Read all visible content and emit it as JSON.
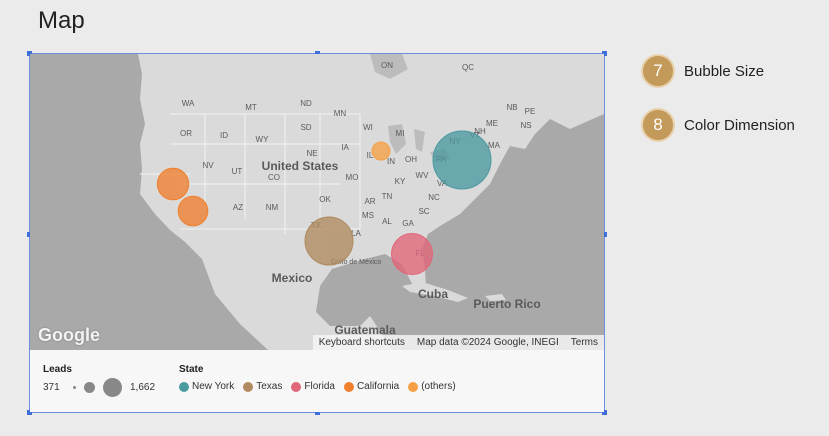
{
  "page": {
    "title": "Map"
  },
  "map": {
    "labels": {
      "countries": [
        "United States",
        "Mexico",
        "Cuba",
        "Puerto Rico",
        "Guatemala"
      ],
      "states": [
        "WA",
        "MT",
        "ND",
        "MN",
        "OR",
        "ID",
        "WY",
        "SD",
        "WI",
        "MI",
        "NV",
        "NE",
        "IA",
        "IL",
        "IN",
        "OH",
        "PA",
        "NY",
        "UT",
        "CO",
        "MO",
        "KY",
        "WV",
        "VA",
        "AZ",
        "NM",
        "OK",
        "AR",
        "TN",
        "NC",
        "MS",
        "AL",
        "GA",
        "SC",
        "TX",
        "LA",
        "FL",
        "ME",
        "VT",
        "NH",
        "MA",
        "NB",
        "PE",
        "NS",
        "ON",
        "QC",
        "Golfo de México"
      ]
    },
    "logo": "Google",
    "attribution": {
      "shortcuts": "Keyboard shortcuts",
      "data": "Map data ©2024 Google, INEGI",
      "terms": "Terms"
    },
    "bubbles": [
      {
        "state": "New York",
        "leads": 1662,
        "color": "#4c9aa0"
      },
      {
        "state": "Texas",
        "leads": 1250,
        "color": "#b08a5e"
      },
      {
        "state": "Florida",
        "leads": 1000,
        "color": "#e2667a"
      },
      {
        "state": "California",
        "leads": 700,
        "color": "#f07f2e"
      },
      {
        "state": "California",
        "leads": 650,
        "color": "#f07f2e"
      },
      {
        "state": "Illinois",
        "leads": 371,
        "color": "#f5a045"
      }
    ]
  },
  "legend": {
    "size_title": "Leads",
    "size_min": "371",
    "size_max": "1,662",
    "color_title": "State",
    "states": [
      {
        "name": "New York",
        "color": "#4c9aa0"
      },
      {
        "name": "Texas",
        "color": "#b08a5e"
      },
      {
        "name": "Florida",
        "color": "#e2667a"
      },
      {
        "name": "California",
        "color": "#f07f2e"
      },
      {
        "name": "(others)",
        "color": "#f5a045"
      }
    ]
  },
  "callouts": [
    {
      "number": "7",
      "label": "Bubble Size"
    },
    {
      "number": "8",
      "label": "Color Dimension"
    }
  ]
}
